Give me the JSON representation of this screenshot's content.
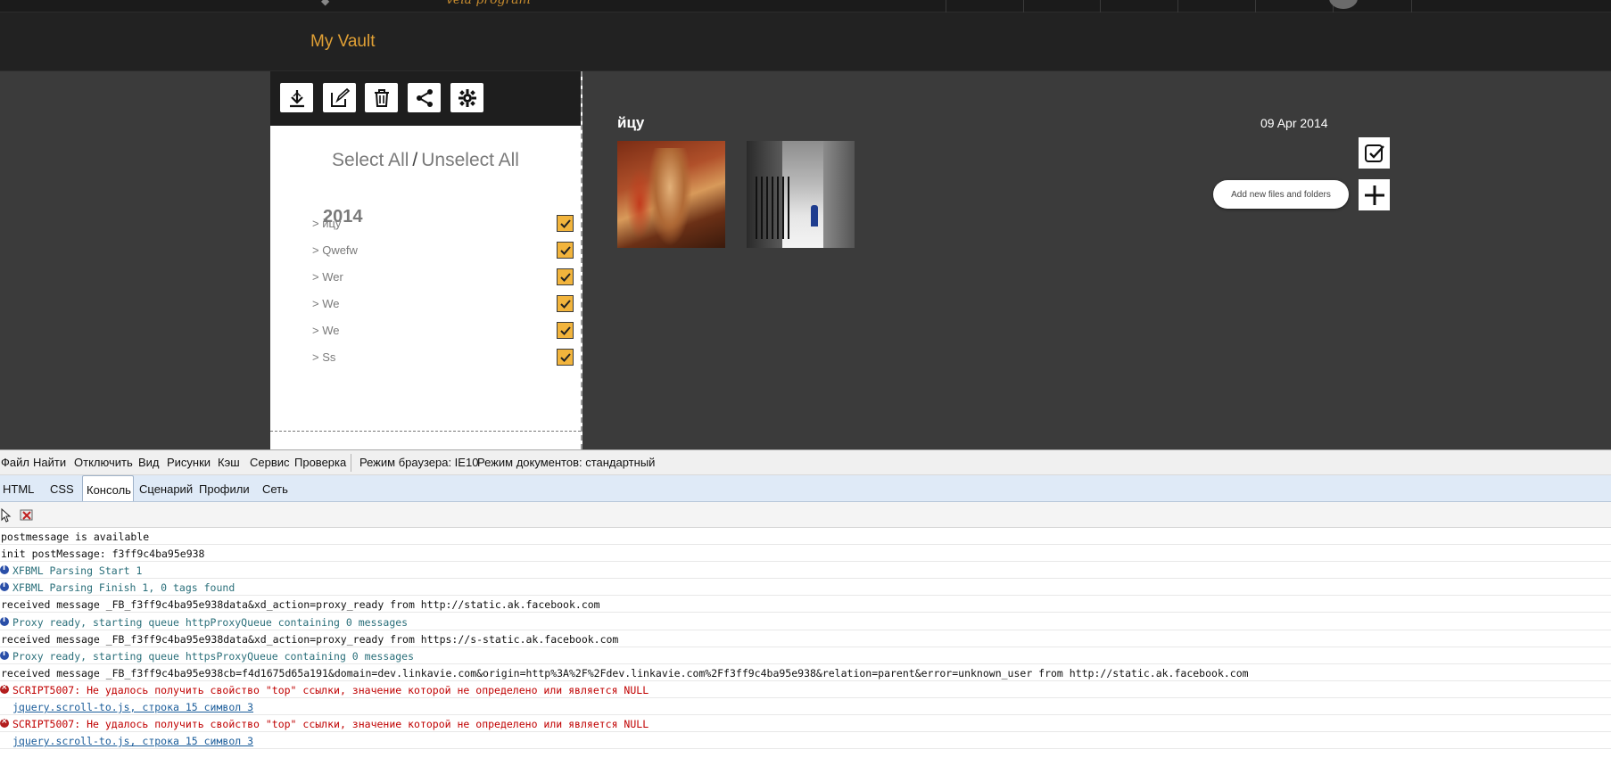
{
  "site": {
    "logo_fragment": "vela program",
    "page_title": "My Vault",
    "toolbar_icons": [
      "download-icon",
      "edit-icon",
      "trash-icon",
      "share-icon",
      "settings-icon"
    ],
    "select_all": "Select All",
    "select_sep": "/",
    "unselect_all": "Unselect All",
    "year": "2014",
    "folders": [
      {
        "label": "> йцу",
        "checked": true
      },
      {
        "label": "> Qwefw",
        "checked": true
      },
      {
        "label": "> Wer",
        "checked": true
      },
      {
        "label": "> We",
        "checked": true
      },
      {
        "label": "> We",
        "checked": true
      },
      {
        "label": "> Ss",
        "checked": true
      }
    ],
    "album": {
      "title": "йцу",
      "date": "09 Apr 2014"
    },
    "add_tooltip": "Add new files and folders",
    "accent_color": "#f2b43c"
  },
  "devtools": {
    "menu": [
      "Файл",
      "Найти",
      "Отключить",
      "Вид",
      "Рисунки",
      "Кэш",
      "Сервис",
      "Проверка"
    ],
    "browser_mode": "Режим браузера: IE10",
    "document_mode": "Режим документов: стандартный",
    "tabs": [
      "HTML",
      "CSS",
      "Консоль",
      "Сценарий",
      "Профили",
      "Сеть"
    ],
    "active_tab": "Консоль",
    "console": [
      {
        "type": "plain",
        "text": "postmessage is available"
      },
      {
        "type": "plain",
        "text": "init postMessage: f3ff9c4ba95e938"
      },
      {
        "type": "info",
        "text": "XFBML Parsing Start 1"
      },
      {
        "type": "info",
        "text": "XFBML Parsing Finish 1, 0 tags found"
      },
      {
        "type": "plain",
        "text": "received message _FB_f3ff9c4ba95e938data&xd_action=proxy_ready from http://static.ak.facebook.com"
      },
      {
        "type": "info",
        "text": "Proxy ready, starting queue httpProxyQueue containing 0 messages"
      },
      {
        "type": "plain",
        "text": "received message _FB_f3ff9c4ba95e938data&xd_action=proxy_ready from https://s-static.ak.facebook.com"
      },
      {
        "type": "info",
        "text": "Proxy ready, starting queue httpsProxyQueue containing 0 messages"
      },
      {
        "type": "plain",
        "text": "received message _FB_f3ff9c4ba95e938cb=f4d1675d65a191&domain=dev.linkavie.com&origin=http%3A%2F%2Fdev.linkavie.com%2Ff3ff9c4ba95e938&relation=parent&error=unknown_user from http://static.ak.facebook.com"
      },
      {
        "type": "error",
        "text": "SCRIPT5007: Не удалось получить свойство \"top\" ссылки, значение которой не определено или является NULL"
      },
      {
        "type": "link",
        "text": "jquery.scroll-to.js, строка 15 символ 3"
      },
      {
        "type": "error",
        "text": "SCRIPT5007: Не удалось получить свойство \"top\" ссылки, значение которой не определено или является NULL"
      },
      {
        "type": "link",
        "text": "jquery.scroll-to.js, строка 15 символ 3"
      }
    ]
  }
}
